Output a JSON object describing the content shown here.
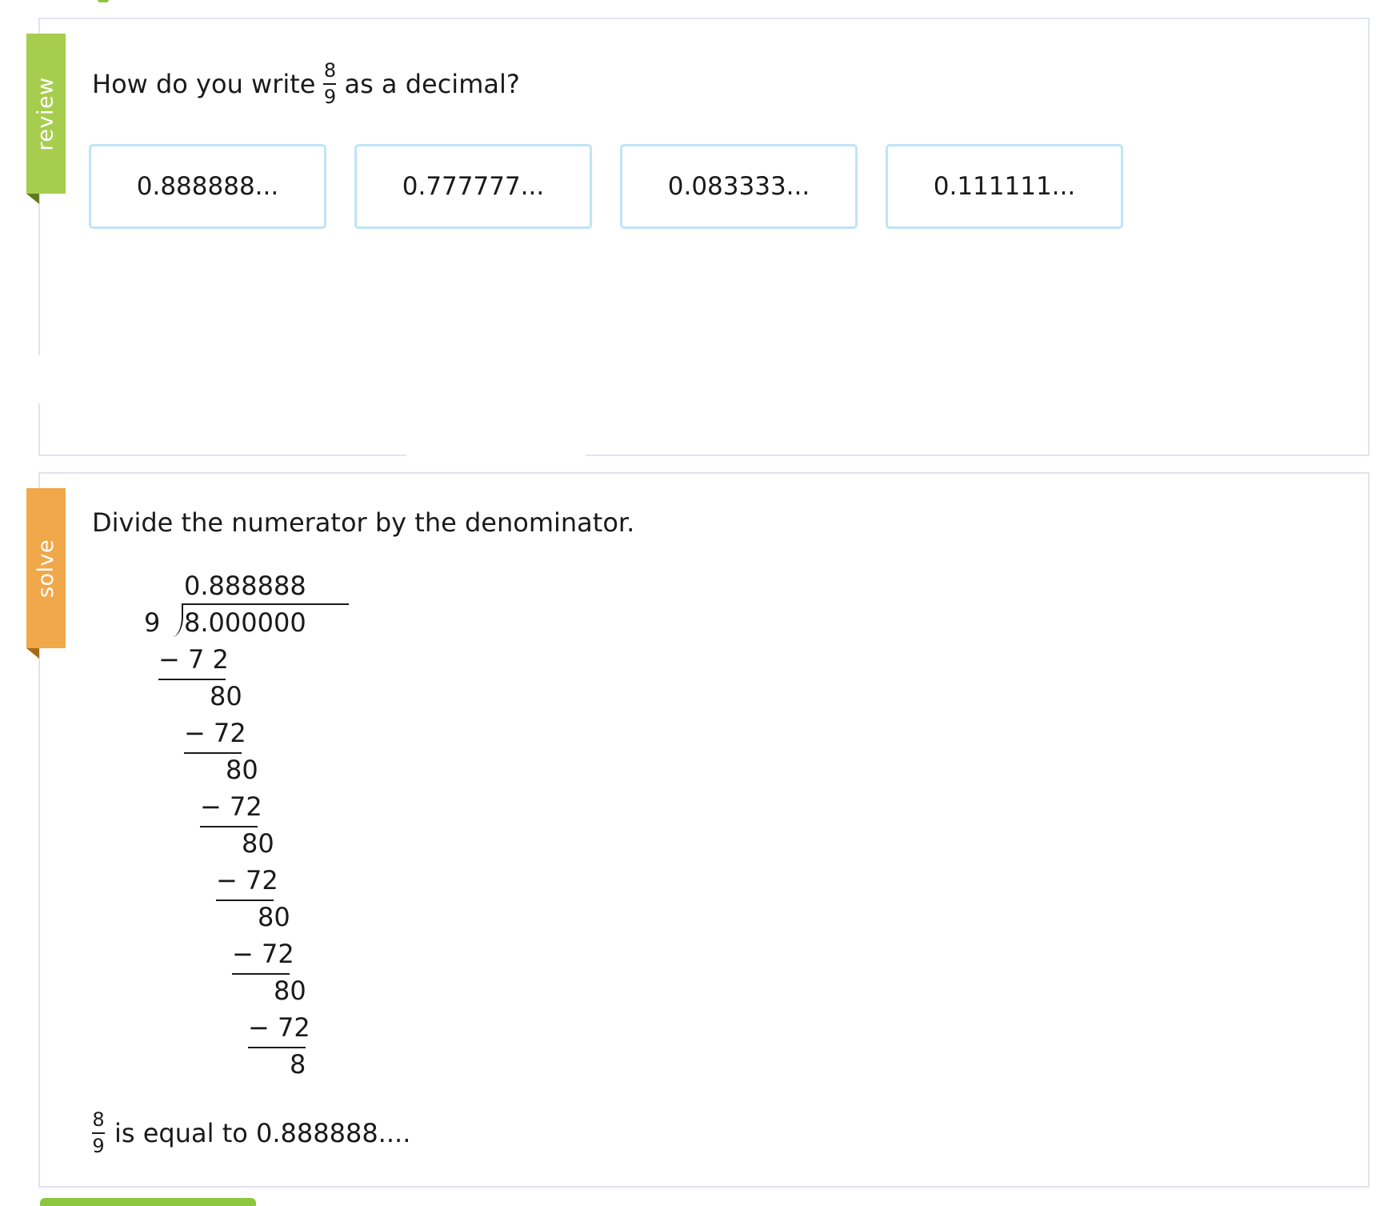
{
  "review": {
    "ribbon_label": "review",
    "question_prefix": "How do you write",
    "fraction": {
      "numerator": "8",
      "denominator": "9"
    },
    "question_suffix": "as a decimal?",
    "choices": [
      "0.888888...",
      "0.777777...",
      "0.083333...",
      "0.111111..."
    ]
  },
  "solve": {
    "ribbon_label": "solve",
    "instruction": "Divide the numerator by the denominator.",
    "long_division": {
      "quotient": "0.888888",
      "divisor": "9",
      "dividend": "8.000000",
      "steps": [
        "− 7 2",
        "80",
        "− 72",
        "80",
        "− 72",
        "80",
        "− 72",
        "80",
        "− 72",
        "80",
        "− 72",
        "8"
      ]
    },
    "conclusion": {
      "fraction": {
        "numerator": "8",
        "denominator": "9"
      },
      "text": "is equal to 0.888888...."
    }
  },
  "colors": {
    "review_ribbon": "#a6cd4e",
    "solve_ribbon": "#f0a84a",
    "choice_border": "#bfe4f6",
    "panel_border": "#e2e3f0"
  }
}
